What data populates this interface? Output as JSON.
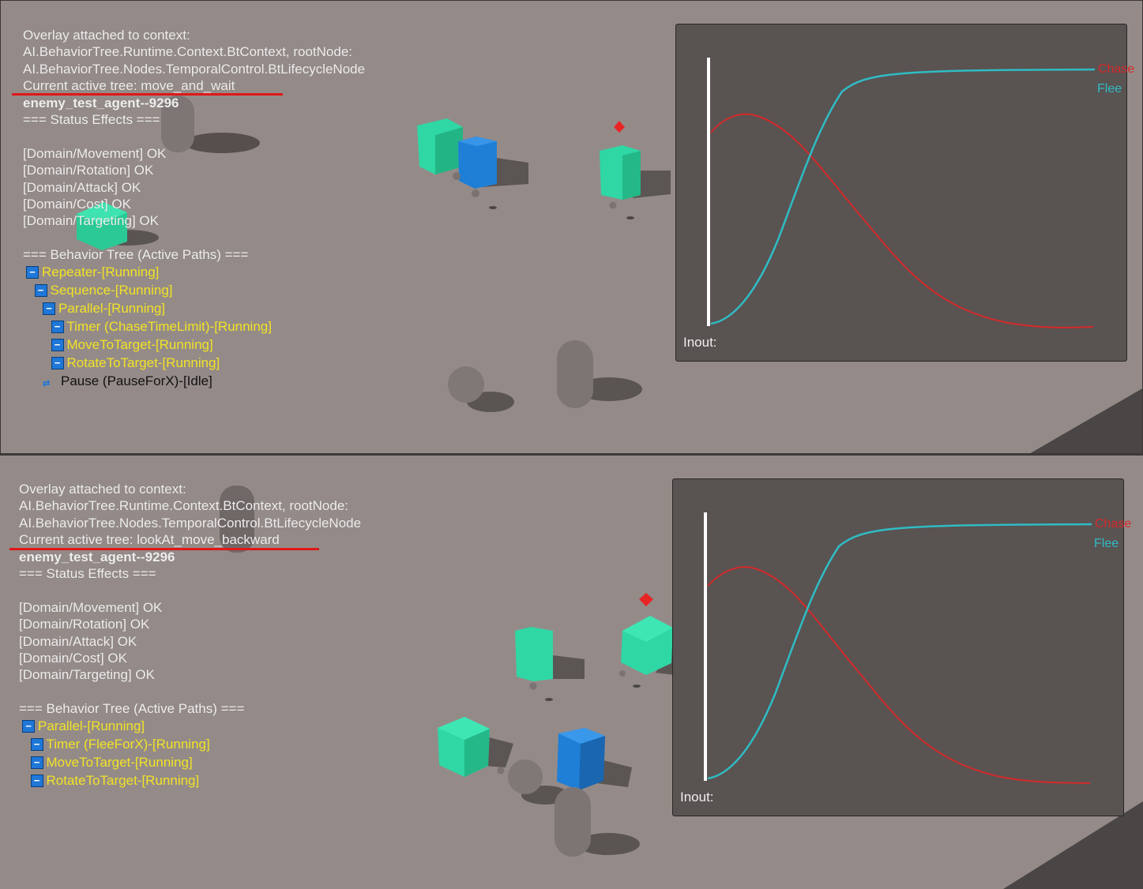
{
  "panels": [
    {
      "overlay": {
        "lines": [
          "Overlay attached to context:",
          "AI.BehaviorTree.Runtime.Context.BtContext, rootNode:",
          "AI.BehaviorTree.Nodes.TemporalControl.BtLifecycleNode",
          "Current active tree: move_and_wait"
        ],
        "agent": "enemy_test_agent--9296",
        "status_header": "=== Status Effects ===",
        "status": [
          "[Domain/Movement]  OK",
          "[Domain/Rotation]  OK",
          "[Domain/Attack]  OK",
          "[Domain/Cost]  OK",
          "[Domain/Targeting]  OK"
        ],
        "tree_header": "=== Behavior Tree (Active Paths) ===",
        "tree": [
          {
            "label": "Repeater-[Running]",
            "depth": 0,
            "state": "running"
          },
          {
            "label": "Sequence-[Running]",
            "depth": 1,
            "state": "running"
          },
          {
            "label": "Parallel-[Running]",
            "depth": 2,
            "state": "running"
          },
          {
            "label": "Timer (ChaseTimeLimit)-[Running]",
            "depth": 3,
            "state": "running"
          },
          {
            "label": "MoveToTarget-[Running]",
            "depth": 3,
            "state": "running"
          },
          {
            "label": "RotateToTarget-[Running]",
            "depth": 3,
            "state": "running"
          },
          {
            "label": "Pause (PauseForX)-[Idle]",
            "depth": 2,
            "state": "idle"
          }
        ]
      },
      "graph": {
        "input_label": "Inout:",
        "legend": [
          "Chase",
          "Flee"
        ]
      }
    },
    {
      "overlay": {
        "lines": [
          "Overlay attached to context:",
          "AI.BehaviorTree.Runtime.Context.BtContext, rootNode:",
          "AI.BehaviorTree.Nodes.TemporalControl.BtLifecycleNode",
          "Current active tree: lookAt_move_backward"
        ],
        "agent": "enemy_test_agent--9296",
        "status_header": "=== Status Effects ===",
        "status": [
          "[Domain/Movement]  OK",
          "[Domain/Rotation]  OK",
          "[Domain/Attack]  OK",
          "[Domain/Cost]  OK",
          "[Domain/Targeting]  OK"
        ],
        "tree_header": "=== Behavior Tree (Active Paths) ===",
        "tree": [
          {
            "label": "Parallel-[Running]",
            "depth": 0,
            "state": "running"
          },
          {
            "label": "Timer (FleeForX)-[Running]",
            "depth": 1,
            "state": "running"
          },
          {
            "label": "MoveToTarget-[Running]",
            "depth": 1,
            "state": "running"
          },
          {
            "label": "RotateToTarget-[Running]",
            "depth": 1,
            "state": "running"
          }
        ]
      },
      "graph": {
        "input_label": "Inout:",
        "legend": [
          "Chase",
          "Flee"
        ]
      }
    }
  ],
  "icons": {
    "expanded": "minus-toggle-icon",
    "idle": "idle-node-icon"
  },
  "colors": {
    "ground": "#948b88",
    "text": "#eeeeee",
    "running": "#f2e227",
    "idle": "#111111",
    "toggle": "#1f77d8",
    "chase": "#d42a2a",
    "flee": "#2fbcc4",
    "highlight": "#e01818",
    "cube_green": "#2fd7a4",
    "cube_blue": "#1f7fd6",
    "red_marker": "#e82525"
  }
}
